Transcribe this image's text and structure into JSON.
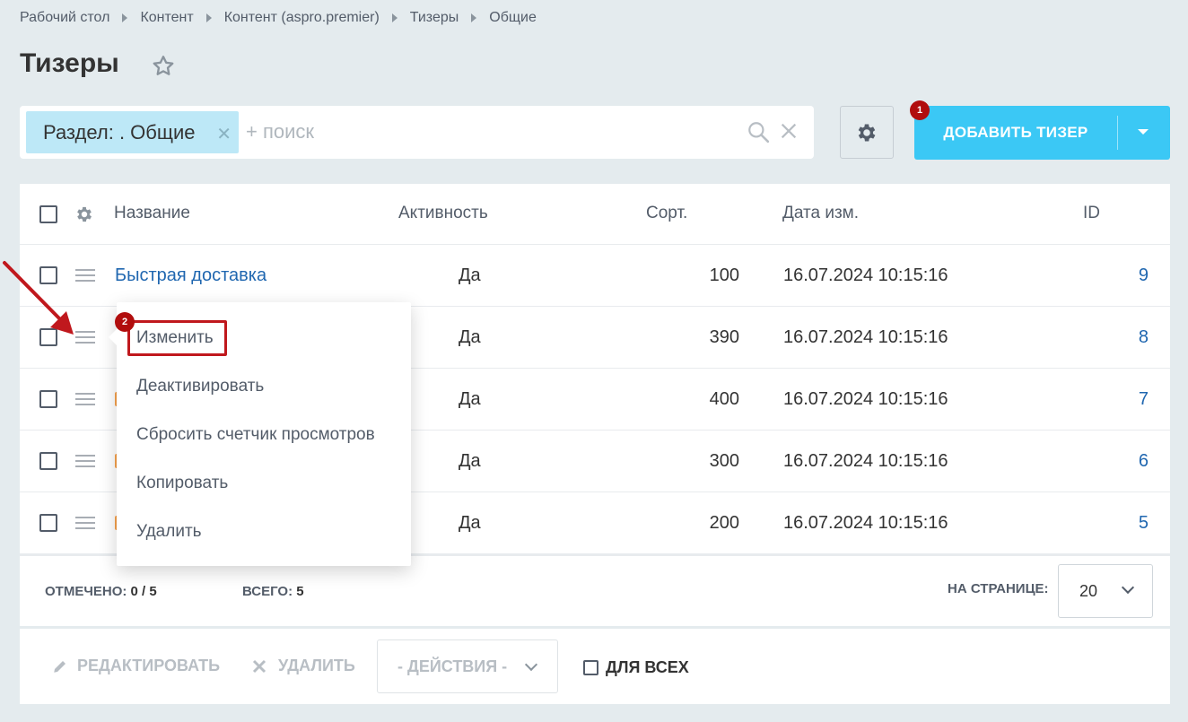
{
  "breadcrumb": [
    "Рабочий стол",
    "Контент",
    "Контент (aspro.premier)",
    "Тизеры",
    "Общие"
  ],
  "page": {
    "title": "Тизеры"
  },
  "filter": {
    "chip_label": "Раздел: . Общие",
    "search_placeholder": "+ поиск"
  },
  "toolbar": {
    "add_button_label": "ДОБАВИТЬ ТИЗЕР",
    "badge_1": "1",
    "badge_2": "2"
  },
  "table": {
    "headers": {
      "name": "Название",
      "active": "Активность",
      "sort": "Сорт.",
      "date": "Дата изм.",
      "id": "ID"
    },
    "rows": [
      {
        "name": "Быстрая доставка",
        "active": "Да",
        "sort": "100",
        "date": "16.07.2024 10:15:16",
        "id": "9"
      },
      {
        "name": "",
        "active": "Да",
        "sort": "390",
        "date": "16.07.2024 10:15:16",
        "id": "8"
      },
      {
        "name": "",
        "active": "Да",
        "sort": "400",
        "date": "16.07.2024 10:15:16",
        "id": "7"
      },
      {
        "name": "",
        "active": "Да",
        "sort": "300",
        "date": "16.07.2024 10:15:16",
        "id": "6"
      },
      {
        "name": "",
        "active": "Да",
        "sort": "200",
        "date": "16.07.2024 10:15:16",
        "id": "5"
      }
    ]
  },
  "footer": {
    "selected_label": "ОТМЕЧЕНО:",
    "selected_value": "0 / 5",
    "total_label": "ВСЕГО:",
    "total_value": "5",
    "per_page_label": "НА СТРАНИЦЕ:",
    "per_page_value": "20"
  },
  "actions": {
    "edit_label": "РЕДАКТИРОВАТЬ",
    "delete_label": "УДАЛИТЬ",
    "actions_select": "- ДЕЙСТВИЯ -",
    "for_all_label": "ДЛЯ ВСЕХ"
  },
  "context_menu": {
    "items": [
      "Изменить",
      "Деактивировать",
      "Сбросить счетчик просмотров",
      "Копировать",
      "Удалить"
    ]
  },
  "colors": {
    "accent": "#3bc8f5",
    "link": "#2067b0",
    "badge": "#b10d0d",
    "highlight": "#c0181d"
  },
  "icons": [
    "star-icon",
    "search-icon",
    "close-icon",
    "gear-icon",
    "chevron-down-icon",
    "pencil-icon",
    "cross-icon",
    "drag-handle-icon",
    "red-arrow-annotation"
  ]
}
